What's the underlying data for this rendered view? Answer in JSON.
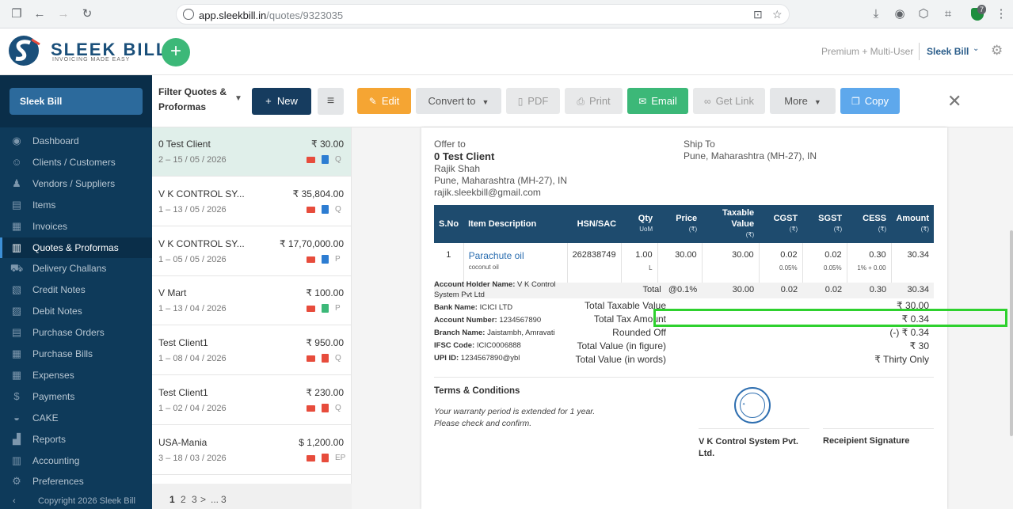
{
  "browser": {
    "url_host": "app.sleekbill.in",
    "url_path": "/quotes/9323035",
    "ext_count": "7"
  },
  "app": {
    "brand": "SLEEK BILL",
    "tagline": "INVOICING MADE EASY",
    "plan": "Premium + Multi-User",
    "account": "Sleek Bill"
  },
  "sidebar": {
    "company": "Sleek Bill",
    "items": [
      {
        "label": "Dashboard",
        "icon": "eye-icon",
        "glyph": "◉"
      },
      {
        "label": "Clients / Customers",
        "icon": "users-icon",
        "glyph": "☺"
      },
      {
        "label": "Vendors / Suppliers",
        "icon": "vendors-icon",
        "glyph": "♟"
      },
      {
        "label": "Items",
        "icon": "items-icon",
        "glyph": "▤"
      },
      {
        "label": "Invoices",
        "icon": "invoice-icon",
        "glyph": "▦"
      },
      {
        "label": "Quotes & Proformas",
        "icon": "quote-icon",
        "glyph": "▥"
      },
      {
        "label": "Delivery Challans",
        "icon": "truck-icon",
        "glyph": "⛟"
      },
      {
        "label": "Credit Notes",
        "icon": "credit-note-icon",
        "glyph": "▧"
      },
      {
        "label": "Debit Notes",
        "icon": "debit-note-icon",
        "glyph": "▨"
      },
      {
        "label": "Purchase Orders",
        "icon": "purchase-order-icon",
        "glyph": "▤"
      },
      {
        "label": "Purchase Bills",
        "icon": "purchase-bill-icon",
        "glyph": "▦"
      },
      {
        "label": "Expenses",
        "icon": "calculator-icon",
        "glyph": "▦"
      },
      {
        "label": "Payments",
        "icon": "dollar-icon",
        "glyph": "$"
      },
      {
        "label": "CAKE",
        "icon": "cake-icon",
        "glyph": "◒"
      },
      {
        "label": "Reports",
        "icon": "reports-icon",
        "glyph": "▟"
      },
      {
        "label": "Accounting",
        "icon": "accounting-icon",
        "glyph": "▥"
      },
      {
        "label": "Preferences",
        "icon": "preferences-icon",
        "glyph": "⚙"
      }
    ],
    "footer": "Copyright 2026 Sleek Bill"
  },
  "list": {
    "filter": "Filter Quotes & Proformas",
    "new_label": "New",
    "items": [
      {
        "name": "0 Test Client",
        "amount": "₹ 30.00",
        "sub": "2 – 15 / 05 / 2026",
        "tag": "Q",
        "doc": "#2d7dd2"
      },
      {
        "name": "V K CONTROL SY...",
        "amount": "₹ 35,804.00",
        "sub": "1 – 13 / 05 / 2026",
        "tag": "Q",
        "doc": "#2d7dd2"
      },
      {
        "name": "V K CONTROL SY...",
        "amount": "₹ 17,70,000.00",
        "sub": "1 – 05 / 05 / 2026",
        "tag": "P",
        "doc": "#2d7dd2"
      },
      {
        "name": "V Mart",
        "amount": "₹ 100.00",
        "sub": "1 – 13 / 04 / 2026",
        "tag": "P",
        "doc": "#3cb878"
      },
      {
        "name": "Test Client1",
        "amount": "₹ 950.00",
        "sub": "1 – 08 / 04 / 2026",
        "tag": "Q",
        "doc": "#e74c3c"
      },
      {
        "name": "Test Client1",
        "amount": "₹ 230.00",
        "sub": "1 – 02 / 04 / 2026",
        "tag": "Q",
        "doc": "#e74c3c"
      },
      {
        "name": "USA-Mania",
        "amount": "$ 1,200.00",
        "sub": "3 – 18 / 03 / 2026",
        "tag": "EP",
        "doc": "#e74c3c"
      }
    ],
    "pager": [
      "1",
      "2",
      "3",
      ">",
      "...",
      "3"
    ]
  },
  "toolbar": {
    "edit": "Edit",
    "convert": "Convert to",
    "pdf": "PDF",
    "print": "Print",
    "email": "Email",
    "link": "Get Link",
    "more": "More",
    "copy": "Copy"
  },
  "doc": {
    "offer_to_label": "Offer to",
    "client": "0 Test Client",
    "contact": "Rajik Shah",
    "address": "Pune, Maharashtra (MH-27), IN",
    "email": "rajik.sleekbill@gmail.com",
    "ship_to_label": "Ship To",
    "ship_address": "Pune, Maharashtra (MH-27), IN",
    "headers": {
      "sno": "S.No",
      "item": "Item Description",
      "hsn": "HSN/SAC",
      "qty": "Qty",
      "qty_u": "UoM",
      "price": "Price",
      "price_u": "(₹)",
      "taxable": "Taxable Value",
      "taxable_u": "(₹)",
      "cgst": "CGST",
      "cgst_u": "(₹)",
      "sgst": "SGST",
      "sgst_u": "(₹)",
      "cess": "CESS",
      "cess_u": "(₹)",
      "amount": "Amount",
      "amount_u": "(₹)"
    },
    "row": {
      "sno": "1",
      "item": "Parachute oil",
      "desc": "coconut oil",
      "hsn": "262838749",
      "qty": "1.00",
      "uom": "L",
      "price": "30.00",
      "taxable": "30.00",
      "cgst": "0.02",
      "cgst_rate": "0.05%",
      "sgst": "0.02",
      "sgst_rate": "0.05%",
      "cess": "0.30",
      "cess_rate": "1% + 0.00",
      "amount": "30.34"
    },
    "total_row": {
      "label": "Total",
      "rate": "@0.1%",
      "taxable": "30.00",
      "cgst": "0.02",
      "sgst": "0.02",
      "cess": "0.30",
      "amount": "30.34"
    },
    "bank": {
      "holder_label": "Account Holder Name:",
      "holder": "V K Control System Pvt Ltd",
      "bank_label": "Bank Name:",
      "bank": "ICICI LTD",
      "acno_label": "Account Number:",
      "acno": "1234567890",
      "branch_label": "Branch Name:",
      "branch": "Jaistambh, Amravati",
      "ifsc_label": "IFSC Code:",
      "ifsc": "ICIC0006888",
      "upi_label": "UPI ID:",
      "upi": "1234567890@ybl"
    },
    "summary": [
      {
        "label": "Total Taxable Value",
        "value": "₹ 30.00"
      },
      {
        "label": "Total Tax Amount",
        "value": "₹ 0.34"
      },
      {
        "label": "Rounded Off",
        "value": "(-) ₹ 0.34"
      },
      {
        "label": "Total Value (in figure)",
        "value": "₹ 30"
      },
      {
        "label": "Total Value (in words)",
        "value": "₹ Thirty Only"
      }
    ],
    "terms_title": "Terms & Conditions",
    "terms_1": "Your warranty period is extended for 1 year.",
    "terms_2": "Please check and confirm.",
    "signer": "V K Control System Pvt. Ltd.",
    "recipient": "Receipient Signature"
  },
  "colors": {
    "sidebar": "#0e3a5a",
    "accent_green": "#3cb878",
    "highlight": "#2ed12e",
    "table_header": "#1e4b6e"
  }
}
